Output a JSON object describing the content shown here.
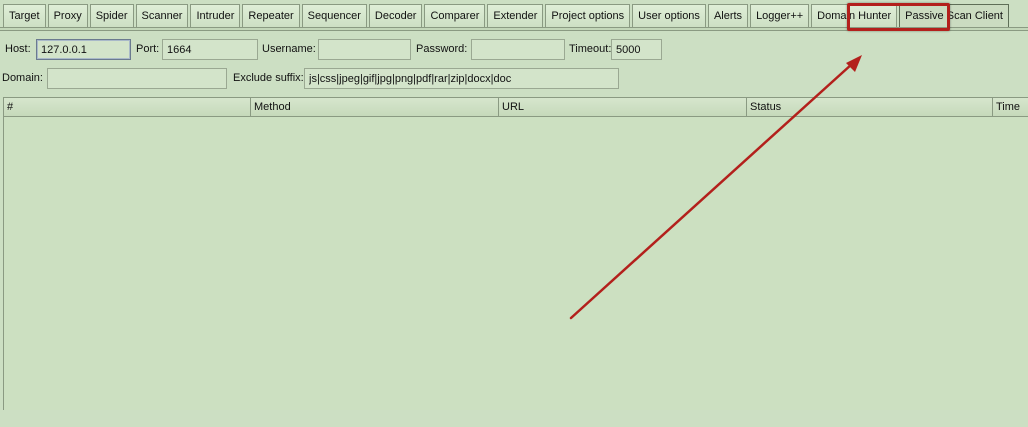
{
  "tabs": [
    {
      "label": "Target"
    },
    {
      "label": "Proxy"
    },
    {
      "label": "Spider"
    },
    {
      "label": "Scanner"
    },
    {
      "label": "Intruder"
    },
    {
      "label": "Repeater"
    },
    {
      "label": "Sequencer"
    },
    {
      "label": "Decoder"
    },
    {
      "label": "Comparer"
    },
    {
      "label": "Extender"
    },
    {
      "label": "Project options"
    },
    {
      "label": "User options"
    },
    {
      "label": "Alerts"
    },
    {
      "label": "Logger++"
    },
    {
      "label": "Domain Hunter"
    },
    {
      "label": "Passive Scan Client"
    }
  ],
  "active_tab": "Passive Scan Client",
  "form": {
    "host_label": "Host:",
    "host_value": "127.0.0.1",
    "port_label": "Port:",
    "port_value": "1664",
    "username_label": "Username:",
    "username_value": "",
    "password_label": "Password:",
    "password_value": "",
    "timeout_label": "Timeout:",
    "timeout_value": "5000",
    "domain_label": "Domain:",
    "domain_value": "",
    "exclude_label": "Exclude suffix:",
    "exclude_value": "js|css|jpeg|gif|jpg|png|pdf|rar|zip|docx|doc"
  },
  "table": {
    "columns": [
      "#",
      "Method",
      "URL",
      "Status",
      "Time"
    ],
    "rows": []
  },
  "annotation": {
    "color": "#b3201c",
    "shape": "arrow-to-tab"
  }
}
